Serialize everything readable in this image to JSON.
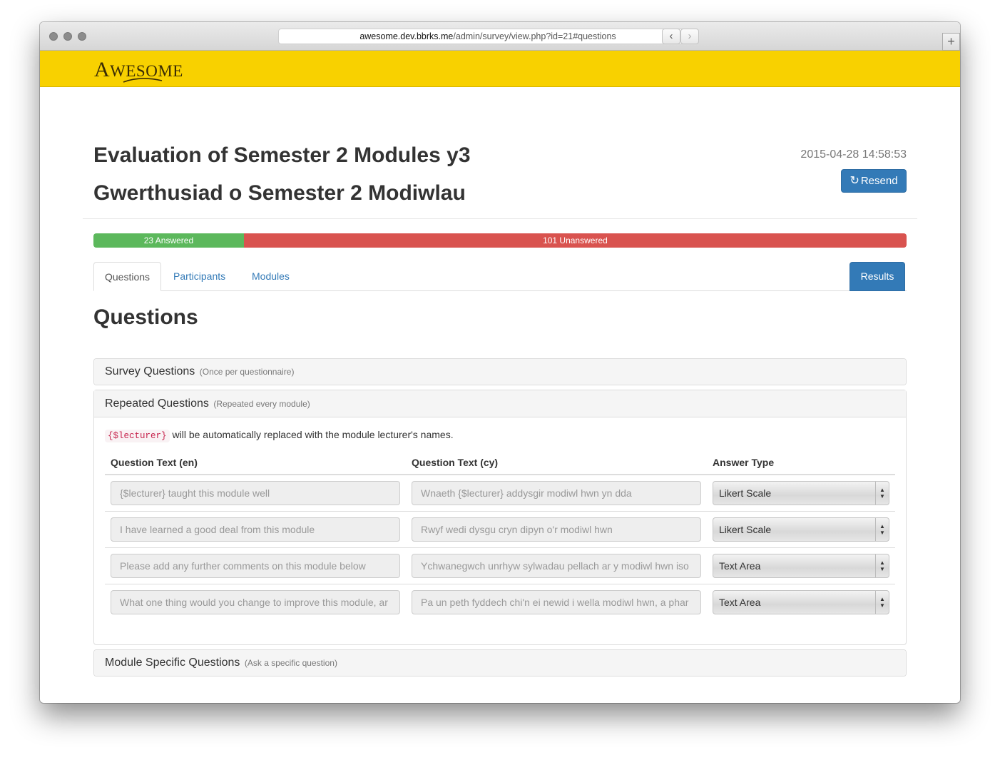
{
  "browser": {
    "url_host": "awesome.dev.bbrks.me",
    "url_path": "/admin/survey/view.php?id=21#questions",
    "reload_glyph": "↻",
    "back_glyph": "‹",
    "forward_glyph": "›",
    "new_tab_glyph": "+"
  },
  "brand": {
    "logo_first": "A",
    "logo_rest": "WESOME",
    "bar_color": "#f8d100"
  },
  "survey": {
    "title_en": "Evaluation of Semester 2 Modules y3",
    "title_cy": "Gwerthusiad o Semester 2 Modiwlau",
    "timestamp": "2015-04-28 14:58:53",
    "resend_label": "Resend",
    "resend_icon": "↻"
  },
  "progress": {
    "answered_label": "23 Answered",
    "unanswered_label": "101 Unanswered",
    "answered_fraction": 0.185,
    "unanswered_fraction": 0.815,
    "answered_color": "#5cb85c",
    "unanswered_color": "#d9534f"
  },
  "tabs": {
    "questions": "Questions",
    "participants": "Participants",
    "modules": "Modules",
    "results": "Results"
  },
  "section_heading": "Questions",
  "panels": {
    "survey": {
      "title": "Survey Questions",
      "subtitle": "(Once per questionnaire)"
    },
    "repeated": {
      "title": "Repeated Questions",
      "subtitle": "(Repeated every module)",
      "note_code": "{$lecturer}",
      "note_text": "will be automatically replaced with the module lecturer's names.",
      "columns": {
        "en": "Question Text (en)",
        "cy": "Question Text (cy)",
        "type": "Answer Type"
      },
      "rows": [
        {
          "en": "{$lecturer} taught this module well",
          "cy": "Wnaeth {$lecturer} addysgir modiwl hwn yn dda",
          "type": "Likert Scale"
        },
        {
          "en": "I have learned a good deal from this module",
          "cy": "Rwyf wedi dysgu cryn dipyn o'r modiwl hwn",
          "type": "Likert Scale"
        },
        {
          "en": "Please add any further comments on this module below",
          "cy": "Ychwanegwch unrhyw sylwadau pellach ar y modiwl hwn iso",
          "type": "Text Area"
        },
        {
          "en": "What one thing would you change to improve this module, ar",
          "cy": "Pa un peth fyddech chi'n ei newid i wella modiwl hwn, a phar",
          "type": "Text Area"
        }
      ]
    },
    "module_specific": {
      "title": "Module Specific Questions",
      "subtitle": "(Ask a specific question)"
    }
  }
}
